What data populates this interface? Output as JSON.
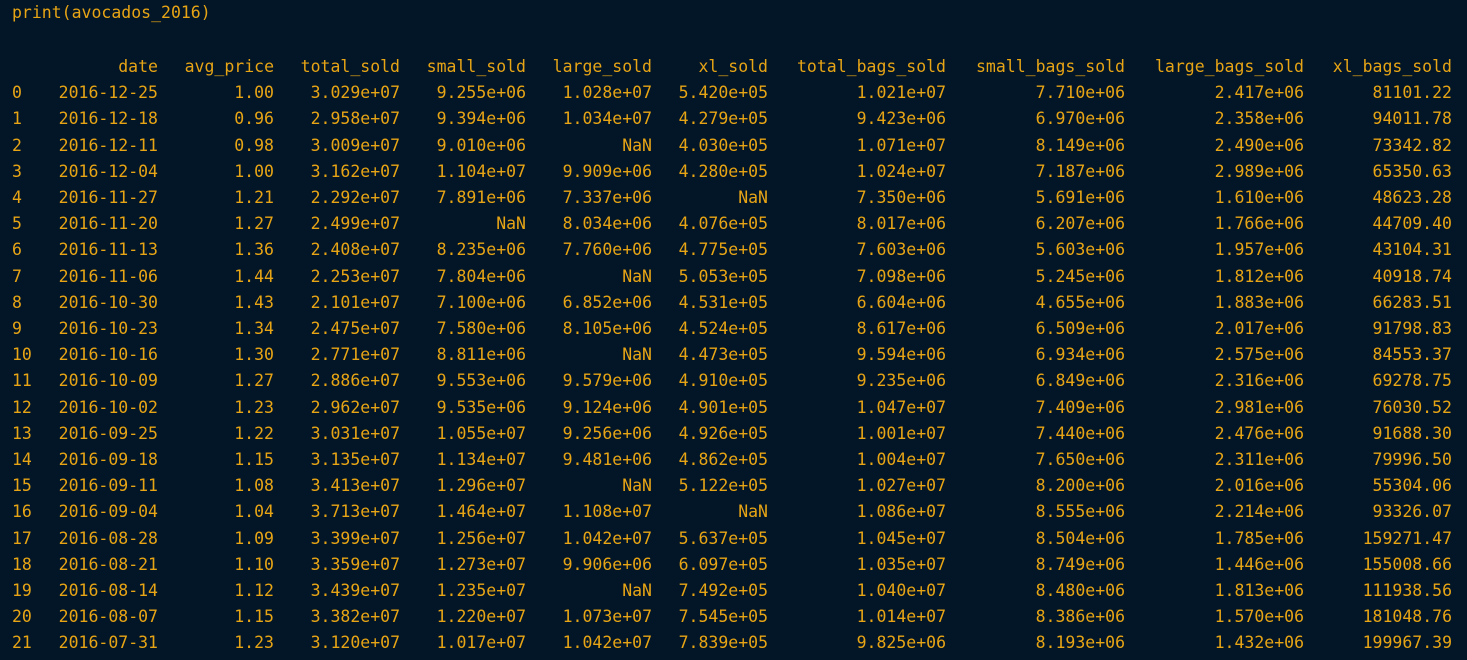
{
  "command": "print(avocados_2016)",
  "colors": {
    "background": "#021628",
    "text": "#e7a415"
  },
  "columns": [
    "",
    "date",
    "avg_price",
    "total_sold",
    "small_sold",
    "large_sold",
    "xl_sold",
    "total_bags_sold",
    "small_bags_sold",
    "large_bags_sold",
    "xl_bags_sold"
  ],
  "rows": [
    [
      "0",
      "2016-12-25",
      "1.00",
      "3.029e+07",
      "9.255e+06",
      "1.028e+07",
      "5.420e+05",
      "1.021e+07",
      "7.710e+06",
      "2.417e+06",
      "81101.22"
    ],
    [
      "1",
      "2016-12-18",
      "0.96",
      "2.958e+07",
      "9.394e+06",
      "1.034e+07",
      "4.279e+05",
      "9.423e+06",
      "6.970e+06",
      "2.358e+06",
      "94011.78"
    ],
    [
      "2",
      "2016-12-11",
      "0.98",
      "3.009e+07",
      "9.010e+06",
      "NaN",
      "4.030e+05",
      "1.071e+07",
      "8.149e+06",
      "2.490e+06",
      "73342.82"
    ],
    [
      "3",
      "2016-12-04",
      "1.00",
      "3.162e+07",
      "1.104e+07",
      "9.909e+06",
      "4.280e+05",
      "1.024e+07",
      "7.187e+06",
      "2.989e+06",
      "65350.63"
    ],
    [
      "4",
      "2016-11-27",
      "1.21",
      "2.292e+07",
      "7.891e+06",
      "7.337e+06",
      "NaN",
      "7.350e+06",
      "5.691e+06",
      "1.610e+06",
      "48623.28"
    ],
    [
      "5",
      "2016-11-20",
      "1.27",
      "2.499e+07",
      "NaN",
      "8.034e+06",
      "4.076e+05",
      "8.017e+06",
      "6.207e+06",
      "1.766e+06",
      "44709.40"
    ],
    [
      "6",
      "2016-11-13",
      "1.36",
      "2.408e+07",
      "8.235e+06",
      "7.760e+06",
      "4.775e+05",
      "7.603e+06",
      "5.603e+06",
      "1.957e+06",
      "43104.31"
    ],
    [
      "7",
      "2016-11-06",
      "1.44",
      "2.253e+07",
      "7.804e+06",
      "NaN",
      "5.053e+05",
      "7.098e+06",
      "5.245e+06",
      "1.812e+06",
      "40918.74"
    ],
    [
      "8",
      "2016-10-30",
      "1.43",
      "2.101e+07",
      "7.100e+06",
      "6.852e+06",
      "4.531e+05",
      "6.604e+06",
      "4.655e+06",
      "1.883e+06",
      "66283.51"
    ],
    [
      "9",
      "2016-10-23",
      "1.34",
      "2.475e+07",
      "7.580e+06",
      "8.105e+06",
      "4.524e+05",
      "8.617e+06",
      "6.509e+06",
      "2.017e+06",
      "91798.83"
    ],
    [
      "10",
      "2016-10-16",
      "1.30",
      "2.771e+07",
      "8.811e+06",
      "NaN",
      "4.473e+05",
      "9.594e+06",
      "6.934e+06",
      "2.575e+06",
      "84553.37"
    ],
    [
      "11",
      "2016-10-09",
      "1.27",
      "2.886e+07",
      "9.553e+06",
      "9.579e+06",
      "4.910e+05",
      "9.235e+06",
      "6.849e+06",
      "2.316e+06",
      "69278.75"
    ],
    [
      "12",
      "2016-10-02",
      "1.23",
      "2.962e+07",
      "9.535e+06",
      "9.124e+06",
      "4.901e+05",
      "1.047e+07",
      "7.409e+06",
      "2.981e+06",
      "76030.52"
    ],
    [
      "13",
      "2016-09-25",
      "1.22",
      "3.031e+07",
      "1.055e+07",
      "9.256e+06",
      "4.926e+05",
      "1.001e+07",
      "7.440e+06",
      "2.476e+06",
      "91688.30"
    ],
    [
      "14",
      "2016-09-18",
      "1.15",
      "3.135e+07",
      "1.134e+07",
      "9.481e+06",
      "4.862e+05",
      "1.004e+07",
      "7.650e+06",
      "2.311e+06",
      "79996.50"
    ],
    [
      "15",
      "2016-09-11",
      "1.08",
      "3.413e+07",
      "1.296e+07",
      "NaN",
      "5.122e+05",
      "1.027e+07",
      "8.200e+06",
      "2.016e+06",
      "55304.06"
    ],
    [
      "16",
      "2016-09-04",
      "1.04",
      "3.713e+07",
      "1.464e+07",
      "1.108e+07",
      "NaN",
      "1.086e+07",
      "8.555e+06",
      "2.214e+06",
      "93326.07"
    ],
    [
      "17",
      "2016-08-28",
      "1.09",
      "3.399e+07",
      "1.256e+07",
      "1.042e+07",
      "5.637e+05",
      "1.045e+07",
      "8.504e+06",
      "1.785e+06",
      "159271.47"
    ],
    [
      "18",
      "2016-08-21",
      "1.10",
      "3.359e+07",
      "1.273e+07",
      "9.906e+06",
      "6.097e+05",
      "1.035e+07",
      "8.749e+06",
      "1.446e+06",
      "155008.66"
    ],
    [
      "19",
      "2016-08-14",
      "1.12",
      "3.439e+07",
      "1.235e+07",
      "NaN",
      "7.492e+05",
      "1.040e+07",
      "8.480e+06",
      "1.813e+06",
      "111938.56"
    ],
    [
      "20",
      "2016-08-07",
      "1.15",
      "3.382e+07",
      "1.220e+07",
      "1.073e+07",
      "7.545e+05",
      "1.014e+07",
      "8.386e+06",
      "1.570e+06",
      "181048.76"
    ],
    [
      "21",
      "2016-07-31",
      "1.23",
      "3.120e+07",
      "1.017e+07",
      "1.042e+07",
      "7.839e+05",
      "9.825e+06",
      "8.193e+06",
      "1.432e+06",
      "199967.39"
    ]
  ]
}
